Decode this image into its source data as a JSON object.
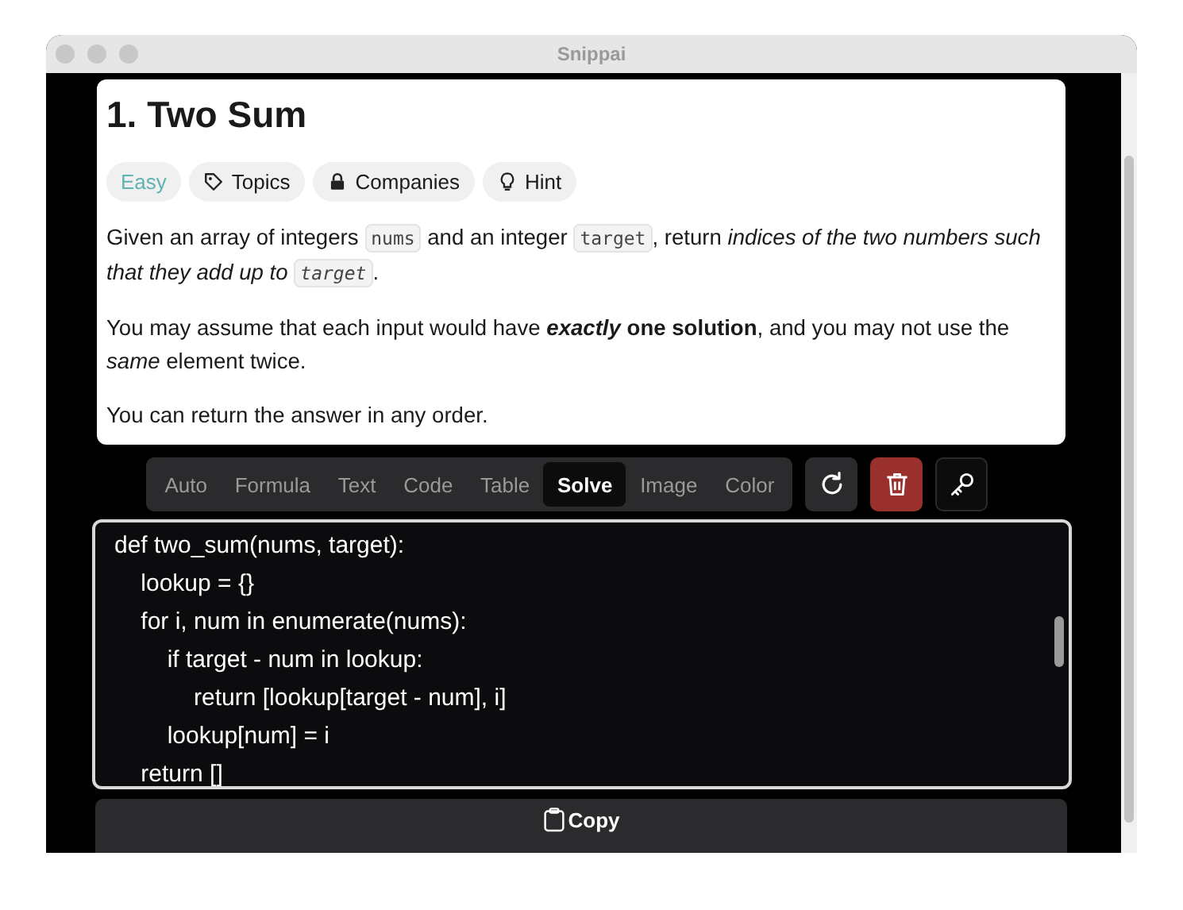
{
  "window": {
    "title": "Snippai"
  },
  "problem": {
    "title": "1. Two Sum",
    "tags": [
      {
        "label": "Easy",
        "kind": "difficulty"
      },
      {
        "label": "Topics",
        "kind": "topics"
      },
      {
        "label": "Companies",
        "kind": "companies"
      },
      {
        "label": "Hint",
        "kind": "hint"
      }
    ],
    "paragraphs": [
      [
        {
          "kind": "text",
          "text": "Given an array of integers "
        },
        {
          "kind": "code",
          "text": "nums",
          "italic": false
        },
        {
          "kind": "text",
          "text": " and an integer "
        },
        {
          "kind": "code",
          "text": "target",
          "italic": false
        },
        {
          "kind": "text",
          "text": ", return *indices of the two numbers such that they add up to* "
        },
        {
          "kind": "code",
          "text": "target",
          "italic": true
        },
        {
          "kind": "text",
          "text": "."
        }
      ],
      [
        {
          "kind": "text",
          "text": "You may assume that each input would have ***exactly* one solution**, and you may not use the *same* element twice."
        }
      ],
      [
        {
          "kind": "text",
          "text": "You can return the answer in any order."
        }
      ]
    ]
  },
  "modes": [
    {
      "label": "Auto",
      "selected": false
    },
    {
      "label": "Formula",
      "selected": false
    },
    {
      "label": "Text",
      "selected": false
    },
    {
      "label": "Code",
      "selected": false
    },
    {
      "label": "Table",
      "selected": false
    },
    {
      "label": "Solve",
      "selected": true
    },
    {
      "label": "Image",
      "selected": false
    },
    {
      "label": "Color",
      "selected": false
    }
  ],
  "actions": [
    {
      "kind": "refresh"
    },
    {
      "kind": "delete"
    },
    {
      "kind": "key"
    }
  ],
  "code": [
    "def two_sum(nums, target):",
    "    lookup = {}",
    "    for i, num in enumerate(nums):",
    "        if target - num in lookup:",
    "            return [lookup[target - num], i]",
    "        lookup[num] = i",
    "    return []"
  ],
  "copy_button": {
    "label": "Copy"
  }
}
